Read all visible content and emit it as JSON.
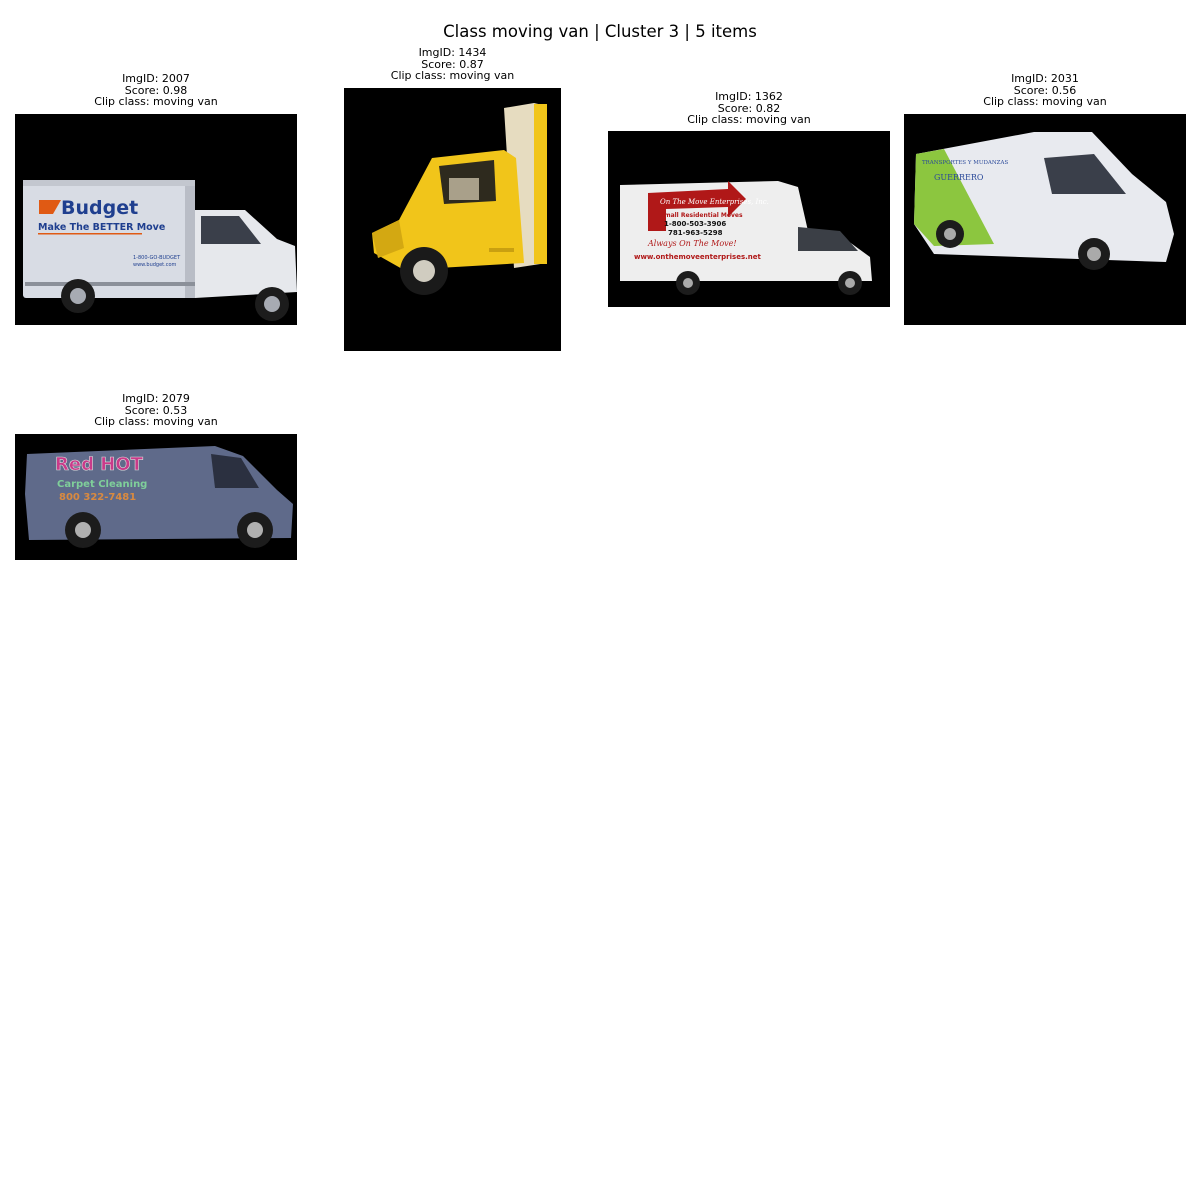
{
  "figure": {
    "title": "Class moving van | Cluster 3 | 5 items"
  },
  "items": [
    {
      "id_line": "ImgID: 2007",
      "score_line": "Score: 0.98",
      "clip_line": "Clip class: moving van",
      "image": {
        "subject": "white box truck with Budget branding",
        "text": [
          "Budget",
          "Make The BETTER Move",
          "1-800-GO-BUDGET",
          "www.budget.com"
        ],
        "colors": {
          "body": "#d8dce4",
          "brand": "#1f3f8f",
          "accent": "#e05a14"
        }
      }
    },
    {
      "id_line": "ImgID: 1434",
      "score_line": "Score: 0.87",
      "clip_line": "Clip class: moving van",
      "image": {
        "subject": "yellow truck cab with box body",
        "colors": {
          "body": "#f1c51a",
          "box": "#e6dcc0"
        }
      }
    },
    {
      "id_line": "ImgID: 1362",
      "score_line": "Score: 0.82",
      "clip_line": "Clip class: moving van",
      "image": {
        "subject": "white box truck with red arrow sign",
        "text": [
          "On The Move Enterprises, Inc.",
          "Small Residential Moves",
          "1-800-503-3906",
          "781-963-5298",
          "Always On The Move!",
          "www.onthemoveenterprises.net"
        ],
        "colors": {
          "body": "#eeeeee",
          "arrow": "#b01818"
        }
      }
    },
    {
      "id_line": "ImgID: 2031",
      "score_line": "Score: 0.56",
      "clip_line": "Clip class: moving van",
      "image": {
        "subject": "white high-roof van with green stripe",
        "text": [
          "TRANSPORTES Y MUDANZAS",
          "GUERRERO"
        ],
        "colors": {
          "body": "#e8eaef",
          "stripe": "#8cc63f"
        }
      }
    },
    {
      "id_line": "ImgID: 2079",
      "score_line": "Score: 0.53",
      "clip_line": "Clip class: moving van",
      "image": {
        "subject": "blue-grey van with graffiti style lettering",
        "text": [
          "Red HOT",
          "Carpet Cleaning",
          "800 322-7481"
        ],
        "colors": {
          "body": "#5f6a8a"
        }
      }
    }
  ]
}
